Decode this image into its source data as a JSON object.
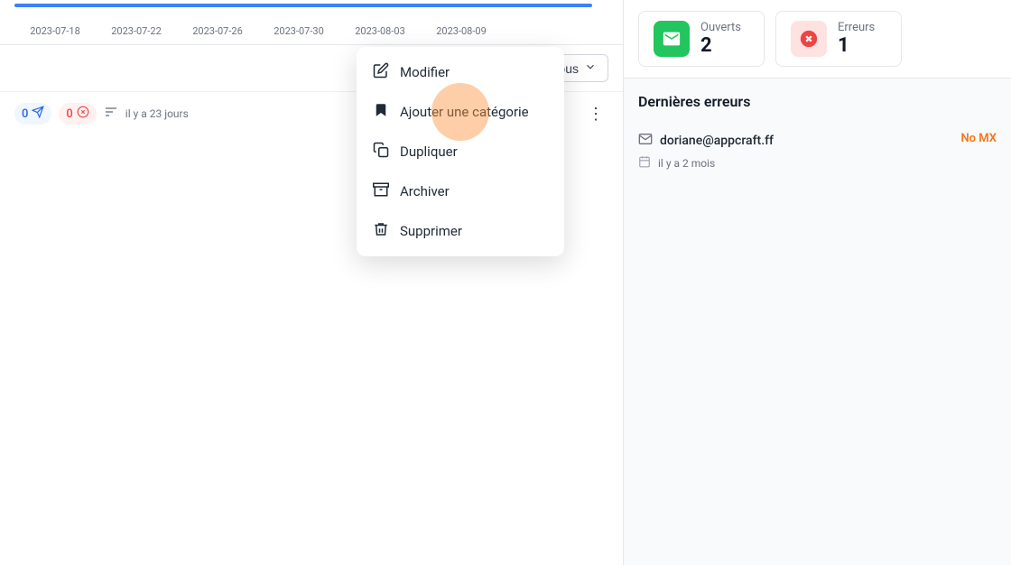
{
  "timeline": {
    "labels": [
      "2023-07-18",
      "2023-07-22",
      "2023-07-26",
      "2023-07-30",
      "2023-08-03",
      "2023-08-09"
    ]
  },
  "filter": {
    "label": "Tous",
    "icon": "bookmark-icon"
  },
  "campaign": {
    "stat_open": "0",
    "stat_error": "0",
    "time_ago": "il y a 23 jours"
  },
  "dropdown": {
    "items": [
      {
        "id": "modifier",
        "label": "Modifier",
        "icon": "edit-icon"
      },
      {
        "id": "add-category",
        "label": "Ajouter une catégorie",
        "icon": "bookmark-add-icon"
      },
      {
        "id": "dupliquer",
        "label": "Dupliquer",
        "icon": "copy-icon"
      },
      {
        "id": "archiver",
        "label": "Archiver",
        "icon": "archive-icon"
      },
      {
        "id": "supprimer",
        "label": "Supprimer",
        "icon": "trash-icon"
      }
    ]
  },
  "stats": {
    "open": {
      "label": "Ouverts",
      "value": "2"
    },
    "errors": {
      "label": "Erreurs",
      "value": "1"
    }
  },
  "errors_section": {
    "title": "Dernières erreurs",
    "items": [
      {
        "email": "doriane@appcraft.ff",
        "date": "il y a 2 mois",
        "badge": "No MX"
      }
    ]
  }
}
